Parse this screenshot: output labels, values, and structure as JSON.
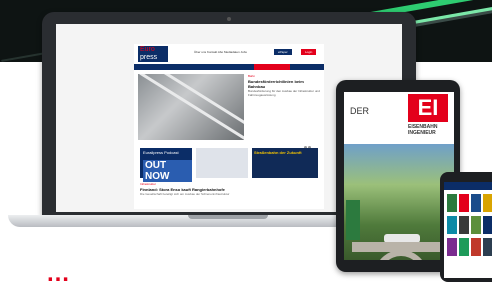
{
  "site": {
    "logo_line1": "Euro",
    "logo_line2": "press",
    "nav_links": "Über uns   Kontakt   Abo   Mediadaten   Jobs",
    "button_epaper": "ePaper",
    "button_login": "Login",
    "hero_kicker": "Bahn",
    "hero_title": "Bundesförderrichtlinien beim Bahnbau",
    "hero_body": "Bundesförderung für den Ausbau der Infrastruktur und Fahrzeugausrüstung",
    "podcast_label": "Eurailpress Podcast",
    "podcast_cta": "OUT NOW",
    "ad3_text": "Straßenbahn der Zukunft",
    "news_kicker": "Infrastruktur",
    "news_title": "Finnland: Stora Enso kauft Rangierbahnhofe",
    "news_body": "Die Gesellschaft beteiligt sich am Ausbau der Schieneninfrastruktur"
  },
  "magazine": {
    "der": "DER",
    "ei": "EI",
    "subtitle_1": "EISENBAHN",
    "subtitle_2": "INGENIEUR"
  },
  "footer": {
    "text": "…"
  },
  "colors": {
    "brand_red": "#e3001b",
    "brand_blue": "#0b2d67",
    "accent_green": "#2ecc71"
  }
}
